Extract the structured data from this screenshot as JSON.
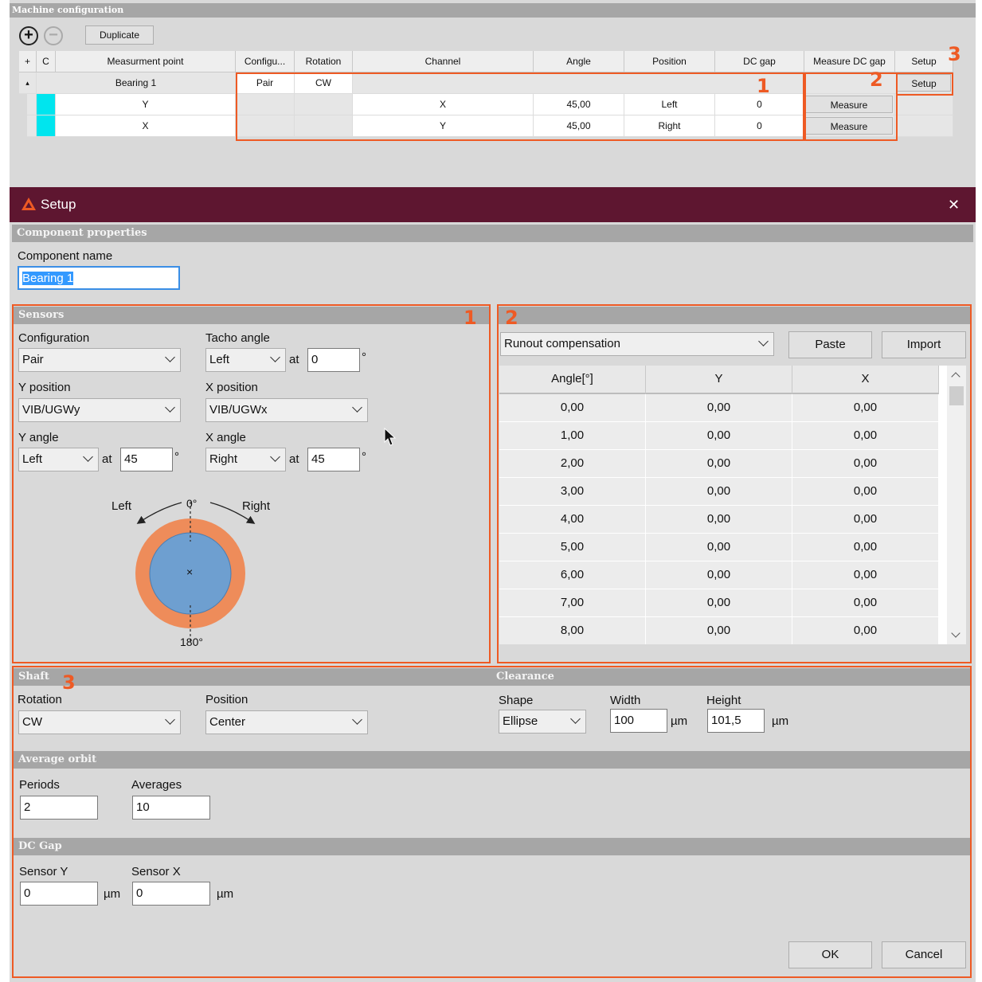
{
  "machine_config": {
    "title": "Machine configuration",
    "duplicate_label": "Duplicate",
    "add_symbol": "+",
    "remove_symbol": "−",
    "columns": [
      "+",
      "C",
      "Measurment point",
      "Configu...",
      "Rotation",
      "Channel",
      "Angle",
      "Position",
      "DC gap",
      "Measure DC gap",
      "Setup"
    ],
    "bearing_row": {
      "expand": "▴",
      "point": "Bearing 1",
      "config": "Pair",
      "rotation": "CW",
      "setup": "Setup"
    },
    "rows": [
      {
        "point": "Y",
        "channel": "X",
        "angle": "45,00",
        "position": "Left",
        "dc_gap": "0",
        "measure": "Measure"
      },
      {
        "point": "X",
        "channel": "Y",
        "angle": "45,00",
        "position": "Right",
        "dc_gap": "0",
        "measure": "Measure"
      }
    ],
    "markers": [
      "1",
      "2",
      "3"
    ]
  },
  "dialog": {
    "title": "Setup",
    "close_symbol": "✕",
    "component_properties": {
      "header": "Component properties",
      "name_label": "Component name",
      "name_value": "Bearing 1"
    },
    "sensors": {
      "header": "Sensors",
      "marker": "1",
      "configuration_label": "Configuration",
      "configuration_value": "Pair",
      "tacho_label": "Tacho angle",
      "tacho_side": "Left",
      "tacho_at": "at",
      "tacho_value": "0",
      "deg": "°",
      "y_position_label": "Y position",
      "y_position_value": "VIB/UGWy",
      "x_position_label": "X position",
      "x_position_value": "VIB/UGWx",
      "y_angle_label": "Y angle",
      "y_angle_side": "Left",
      "y_at": "at",
      "y_angle_value": "45",
      "x_angle_label": "X angle",
      "x_angle_side": "Right",
      "x_at": "at",
      "x_angle_value": "45",
      "diagram": {
        "left": "Left",
        "right": "Right",
        "top": "0°",
        "bottom": "180°",
        "center": "×"
      }
    },
    "runout": {
      "marker": "2",
      "mode_value": "Runout compensation",
      "paste_label": "Paste",
      "import_label": "Import",
      "columns": [
        "Angle[°]",
        "Y",
        "X"
      ],
      "rows": [
        [
          "0,00",
          "0,00",
          "0,00"
        ],
        [
          "1,00",
          "0,00",
          "0,00"
        ],
        [
          "2,00",
          "0,00",
          "0,00"
        ],
        [
          "3,00",
          "0,00",
          "0,00"
        ],
        [
          "4,00",
          "0,00",
          "0,00"
        ],
        [
          "5,00",
          "0,00",
          "0,00"
        ],
        [
          "6,00",
          "0,00",
          "0,00"
        ],
        [
          "7,00",
          "0,00",
          "0,00"
        ],
        [
          "8,00",
          "0,00",
          "0,00"
        ]
      ]
    },
    "shaft": {
      "header": "Shaft",
      "marker": "3",
      "rotation_label": "Rotation",
      "rotation_value": "CW",
      "position_label": "Position",
      "position_value": "Center"
    },
    "clearance": {
      "header": "Clearance",
      "shape_label": "Shape",
      "shape_value": "Ellipse",
      "width_label": "Width",
      "width_value": "100",
      "height_label": "Height",
      "height_value": "101,5",
      "unit": "µm"
    },
    "average_orbit": {
      "header": "Average orbit",
      "periods_label": "Periods",
      "periods_value": "2",
      "averages_label": "Averages",
      "averages_value": "10"
    },
    "dc_gap": {
      "header": "DC Gap",
      "sensor_y_label": "Sensor Y",
      "sensor_y_value": "0",
      "sensor_x_label": "Sensor X",
      "sensor_x_value": "0",
      "unit": "µm"
    },
    "ok_label": "OK",
    "cancel_label": "Cancel"
  },
  "colors": {
    "title_bar": "#5e1630",
    "highlight": "#ee5a24",
    "section_header": "#a6a6a6",
    "cyan_cell": "#00e5ee",
    "disk_outer": "#ee8c5a",
    "disk_inner": "#6e9fd0"
  }
}
